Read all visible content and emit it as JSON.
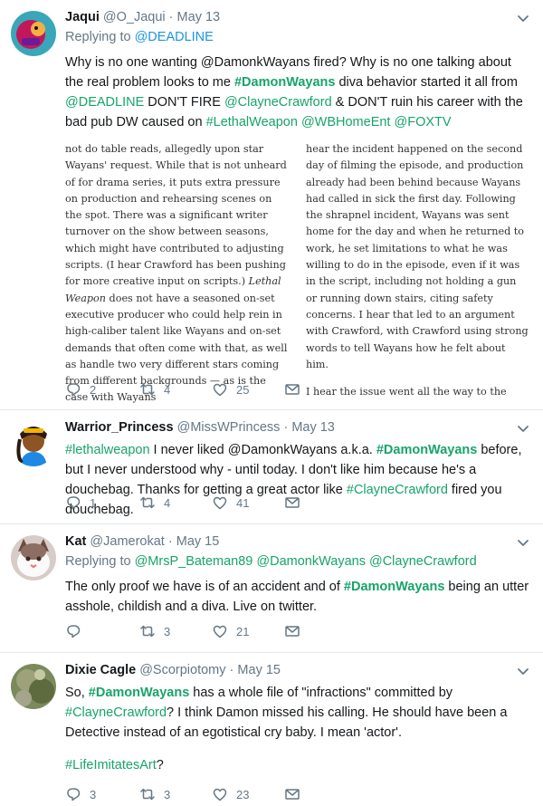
{
  "tweets": [
    {
      "name": "Jaqui",
      "handle": "@O_Jaqui",
      "date": "May 13",
      "reply_prefix": "Replying to",
      "reply_to": [
        "@DEADLINE"
      ],
      "text": [
        {
          "t": "Why is no one wanting @DamonkWayans fired? Why is no one talking about the real problem looks to me "
        },
        {
          "t": "#DamonWayans",
          "s": "bold"
        },
        {
          "t": " diva behavior started it all from "
        },
        {
          "t": "@DEADLINE",
          "s": "link"
        },
        {
          "t": " DON'T FIRE "
        },
        {
          "t": "@ClayneCrawford",
          "s": "link"
        },
        {
          "t": " & DON'T ruin his career with the bad pub DW caused on "
        },
        {
          "t": "#LethalWeapon",
          "s": "link"
        },
        {
          "t": " "
        },
        {
          "t": "@WBHomeEnt",
          "s": "link"
        },
        {
          "t": " "
        },
        {
          "t": "@FOXTV",
          "s": "link"
        }
      ],
      "article": {
        "col1": [
          {
            "t": "not do table reads, allegedly upon star Wayans' request. While that is not unheard of for drama series, it puts extra pressure on production and rehearsing scenes on the spot. There was a significant writer turnover on the show between seasons, which might have contributed to adjusting scripts. (I hear Crawford has been pushing for more creative input on scripts.) "
          },
          {
            "t": "Lethal Weapon",
            "s": "italic"
          },
          {
            "t": " does not have a seasoned on-set executive producer who could help rein in high-caliber talent like Wayans and on-set demands that often come with that, as well as handle two very different stars coming from different backgrounds — as is the case with Wayans"
          }
        ],
        "col2_p1": "hear the incident happened on the second day of filming the episode, and production already had been behind because Wayans had called in sick the first day. Following the shrapnel incident, Wayans was sent home for the day and when he returned to work, he set limitations to what he was willing to do in the episode, even if it was in the script, including not holding a gun or running down stairs, citing safety concerns. I hear that led to an argument with Crawford, with Crawford using strong words to tell Wayans how he felt about him.",
        "col2_p2": "I hear the issue went all the way to the"
      },
      "replies": "2",
      "retweets": "4",
      "likes": "25"
    },
    {
      "name": "Warrior_Princess",
      "handle": "@MissWPrincess",
      "date": "May 13",
      "text": [
        {
          "t": "#lethalweapon",
          "s": "link"
        },
        {
          "t": " I never liked @DamonkWayans a.k.a. "
        },
        {
          "t": "#DamonWayans",
          "s": "bold"
        },
        {
          "t": " before, but I never understood why - until today. I don't like him because he's a douchebag. Thanks for getting a great actor like "
        },
        {
          "t": "#ClayneCrawford",
          "s": "link"
        },
        {
          "t": " fired you douchebag."
        }
      ],
      "replies": "1",
      "retweets": "4",
      "likes": "41"
    },
    {
      "name": "Kat",
      "handle": "@Jamerokat",
      "date": "May 15",
      "reply_prefix": "Replying to",
      "reply_to": [
        "@MrsP_Bateman89",
        "@DamonkWayans",
        "@ClayneCrawford"
      ],
      "text": [
        {
          "t": "The only proof we have is of an accident and of "
        },
        {
          "t": "#DamonWayans",
          "s": "bold"
        },
        {
          "t": " being an utter asshole, childish and a diva. Live on twitter."
        }
      ],
      "replies": "",
      "retweets": "3",
      "likes": "21"
    },
    {
      "name": "Dixie Cagle",
      "handle": "@Scorpiotomy",
      "date": "May 15",
      "text": [
        {
          "t": "So, "
        },
        {
          "t": "#DamonWayans",
          "s": "bold"
        },
        {
          "t": " has a whole file of \"infractions\" committed by "
        },
        {
          "t": "#ClayneCrawford",
          "s": "link"
        },
        {
          "t": "? I think Damon missed his calling. He should have been a Detective instead of an egotistical cry baby. I mean 'actor'."
        }
      ],
      "text2": [
        {
          "t": "#LifeImitatesArt",
          "s": "link"
        },
        {
          "t": "?"
        }
      ],
      "replies": "3",
      "retweets": "3",
      "likes": "23"
    }
  ],
  "icons": {
    "reply": "reply-icon",
    "retweet": "retweet-icon",
    "like": "heart-icon",
    "dm": "envelope-icon",
    "menu": "chevron-down-icon"
  },
  "colors": {
    "link": "#1b95e0",
    "hashtag_bold": "#17a46a",
    "muted": "#657786",
    "text": "#14171a",
    "divider": "#e1e8ed"
  }
}
